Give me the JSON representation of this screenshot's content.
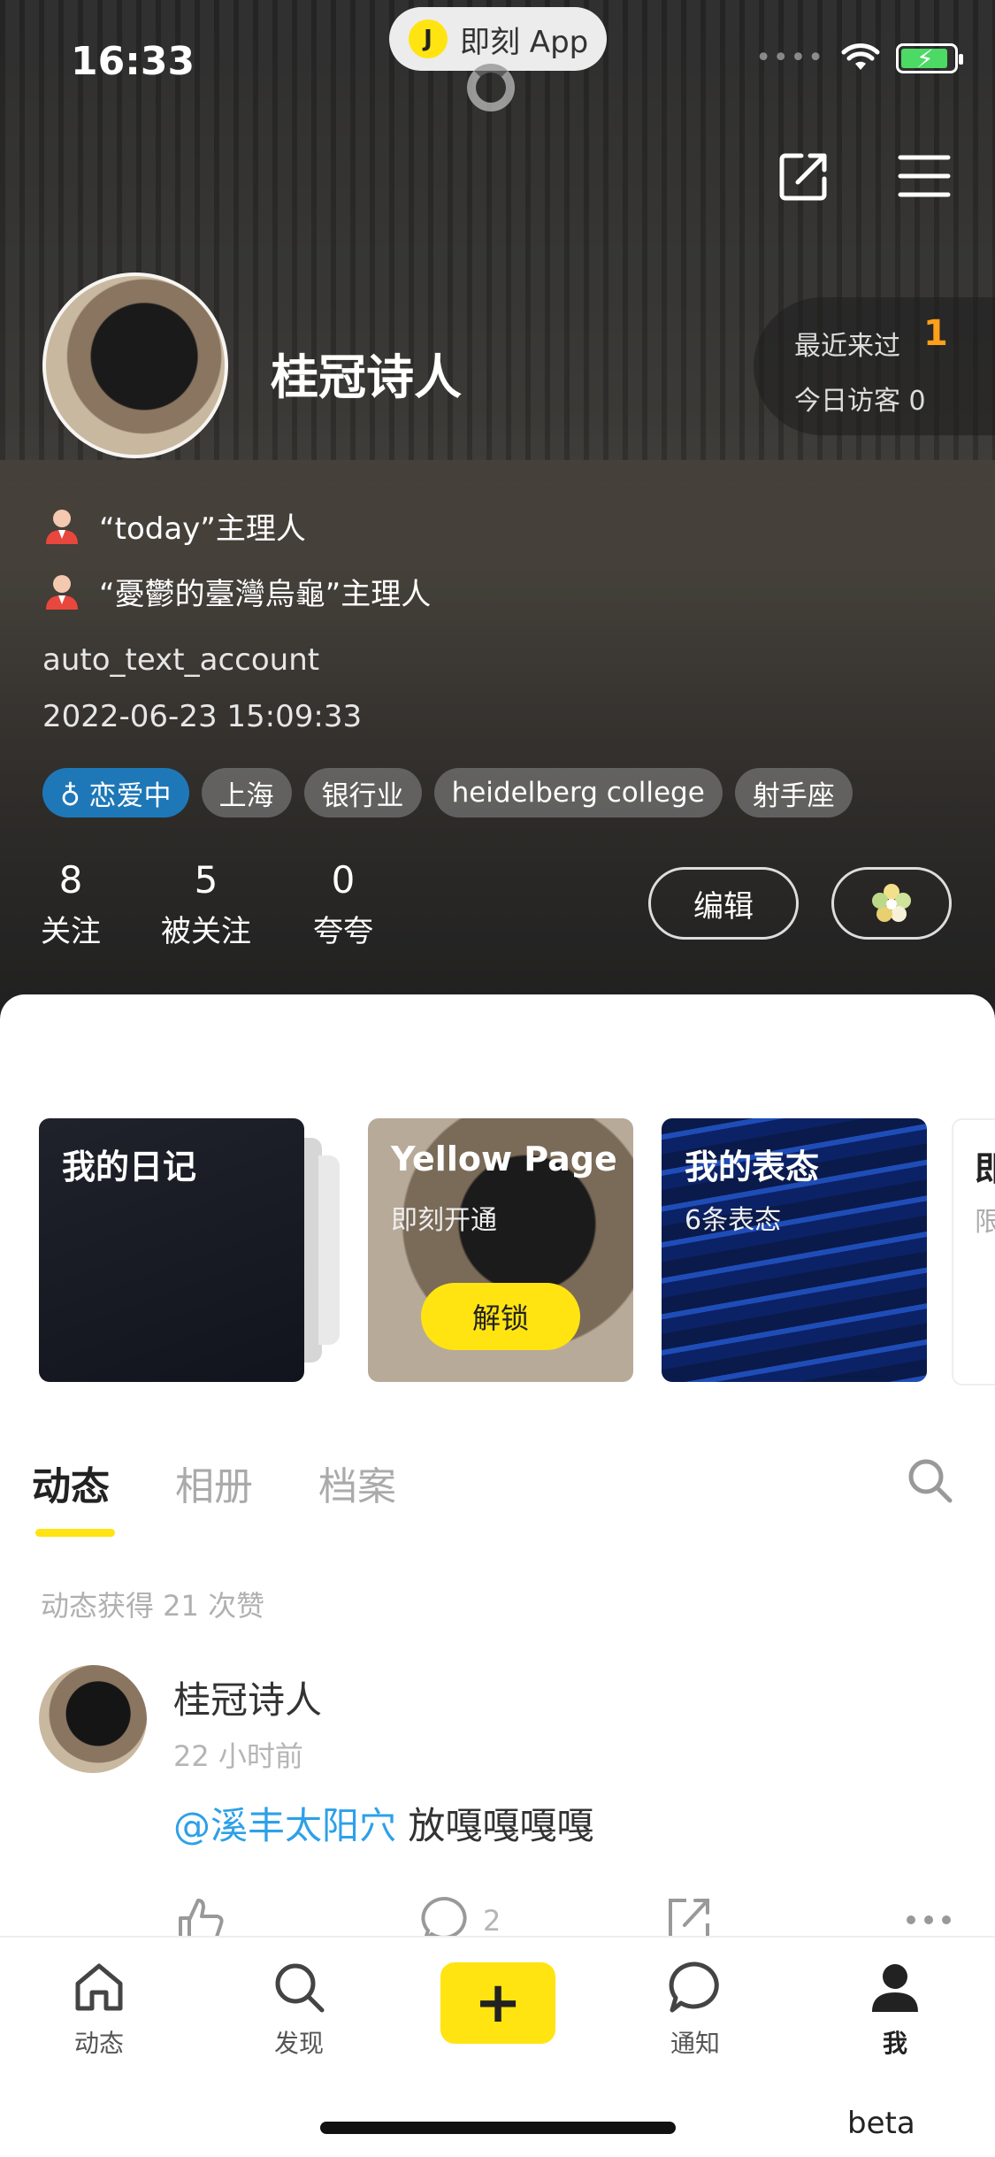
{
  "status_bar": {
    "time": "16:33",
    "app_pill": "即刻 App",
    "app_logo_letter": "J"
  },
  "profile": {
    "name": "桂冠诗人",
    "visitors": {
      "recent_label": "最近来过",
      "recent_count": "1",
      "today_label": "今日访客 0"
    },
    "roles": [
      "“today”主理人",
      "“憂鬱的臺灣烏龜”主理人"
    ],
    "account": "auto_text_account",
    "created": "2022-06-23 15:09:33",
    "tags": [
      "♁ 恋爱中",
      "上海",
      "银行业",
      "heidelberg college",
      "射手座"
    ],
    "stats": [
      {
        "num": "8",
        "label": "关注"
      },
      {
        "num": "5",
        "label": "被关注"
      },
      {
        "num": "0",
        "label": "夸夸"
      }
    ],
    "edit_label": "编辑"
  },
  "cards": {
    "diary": {
      "title": "我的日记"
    },
    "yellow": {
      "title": "Yellow Page",
      "sub": "即刻开通",
      "button": "解锁"
    },
    "express": {
      "title": "我的表态",
      "sub": "6条表态"
    },
    "next": {
      "title": "即",
      "sub": "限"
    }
  },
  "tabs": [
    "动态",
    "相册",
    "档案"
  ],
  "feed": {
    "likes_note": "动态获得 21 次赞",
    "post": {
      "author": "桂冠诗人",
      "time": "22 小时前",
      "mention": "@溪丰太阳穴",
      "text": " 放嘎嘎嘎嘎",
      "comment_count": "2"
    }
  },
  "nav": {
    "items": [
      "动态",
      "发现",
      "通知",
      "我"
    ],
    "add": "+"
  },
  "beta": "beta",
  "colors": {
    "accent": "#ffe411",
    "mention": "#2ea0e8",
    "love_tag": "#1e78b8",
    "visitor_num": "#ff9f1a"
  }
}
